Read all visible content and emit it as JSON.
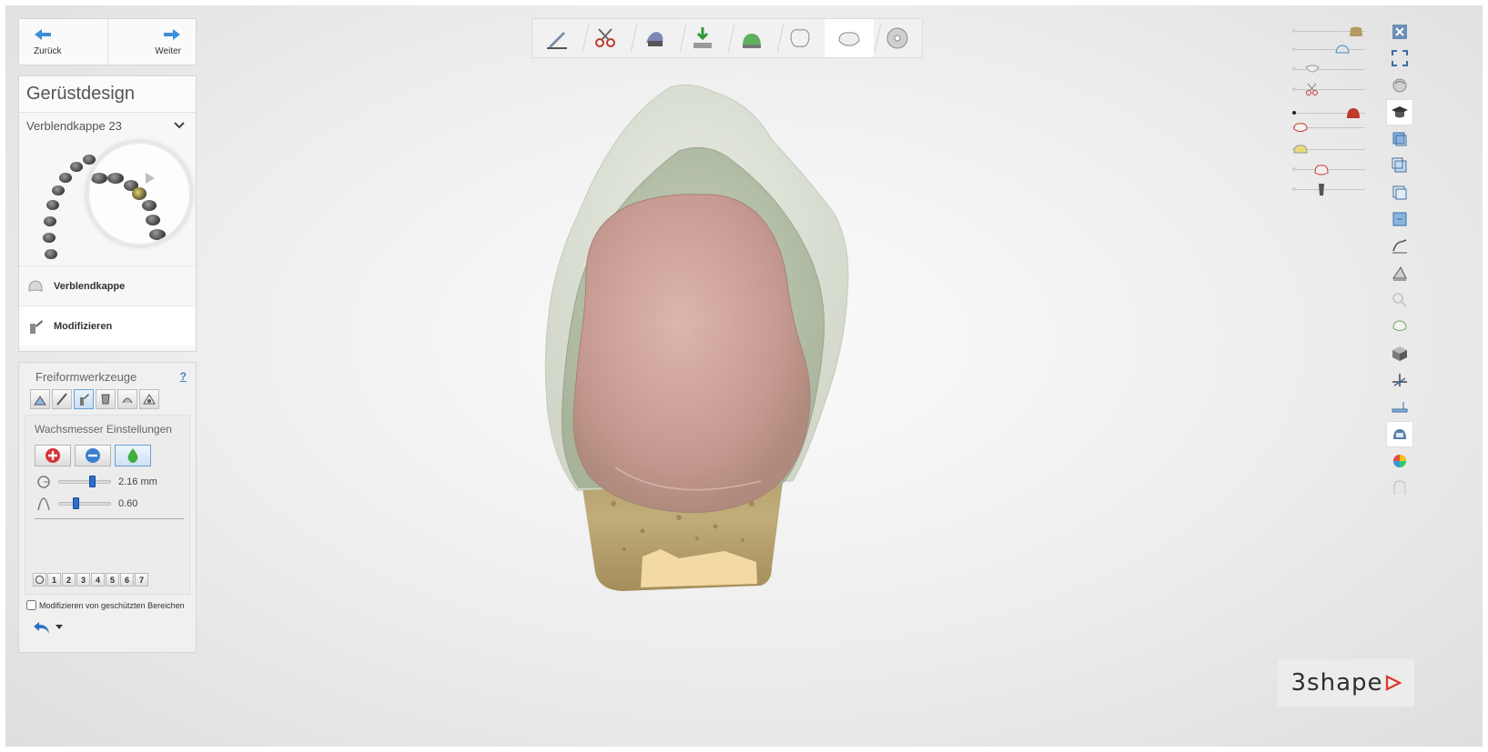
{
  "nav": {
    "back_label": "Zurück",
    "next_label": "Weiter"
  },
  "design": {
    "title": "Gerüstdesign",
    "case_select": "Verblendkappe 23",
    "steps": [
      {
        "label": "Verblendkappe",
        "icon": "coping-icon"
      },
      {
        "label": "Modifizieren",
        "icon": "wax-knife-icon"
      }
    ]
  },
  "tools": {
    "title": "Freiformwerkzeuge",
    "help": "?",
    "tool_icons": [
      "add-material-tool-icon",
      "knife-tool-icon",
      "wax-knife-tool-icon",
      "morph-tool-icon",
      "smooth-tool-icon",
      "transform-tool-icon"
    ],
    "selected_tool": 2,
    "wax": {
      "title": "Wachsmesser Einstellungen",
      "modes": [
        "add-mode-icon",
        "remove-mode-icon",
        "smooth-mode-icon"
      ],
      "selected_mode": 2,
      "radius_value": "2.16 mm",
      "radius_fraction": 0.65,
      "strength_value": "0.60",
      "strength_fraction": 0.32
    },
    "presets": [
      "1",
      "2",
      "3",
      "4",
      "5",
      "6",
      "7"
    ],
    "protect_label": "Modifizieren von geschützten Bereichen",
    "protect_checked": false
  },
  "workflow": {
    "steps": [
      "margin-line-icon",
      "trim-icon",
      "insertion-direction-icon",
      "cement-gap-icon",
      "coping-settings-icon",
      "anatomy-icon",
      "framework-design-icon",
      "save-icon"
    ],
    "active": 6
  },
  "visibility": {
    "rows": [
      {
        "icon": "upper-model-icon",
        "level": 0.92,
        "on": false
      },
      {
        "icon": "die-icon",
        "level": 0.7,
        "on": false
      },
      {
        "icon": "antagonist-icon",
        "level": 0.2,
        "on": false
      },
      {
        "icon": "scissors-icon",
        "level": 0.2,
        "on": false
      },
      {
        "icon": "gingiva-icon",
        "level": 0.88,
        "on": true
      },
      {
        "icon": "coping-visibility-icon",
        "level": 0.0,
        "on": false
      },
      {
        "icon": "cement-icon",
        "level": 0.0,
        "on": false
      },
      {
        "icon": "crown-icon",
        "level": 0.35,
        "on": false
      },
      {
        "icon": "implant-icon",
        "level": 0.35,
        "on": false
      }
    ]
  },
  "right_toolbar": [
    "close-icon",
    "fullscreen-icon",
    "view-rotate-icon",
    "graduation-cap-icon",
    "view-front-icon",
    "view-back-icon",
    "view-left-icon",
    "view-right-icon",
    "clip-plane-icon",
    "measure-icon",
    "zoom-disabled-icon",
    "occlusion-icon",
    "cube-view-icon",
    "cross-section-icon",
    "ruler-icon",
    "scan-compare-icon",
    "color-map-icon",
    "transparency-icon"
  ],
  "right_toolbar_active": [
    3,
    15
  ],
  "logo": {
    "text": "3shape",
    "color": "#e0342c"
  },
  "colors": {
    "accent_blue": "#2d6fd0",
    "coping_pink": "#c89a92",
    "shell_green": "#b9c4ad",
    "die_gold": "#b39a63"
  }
}
